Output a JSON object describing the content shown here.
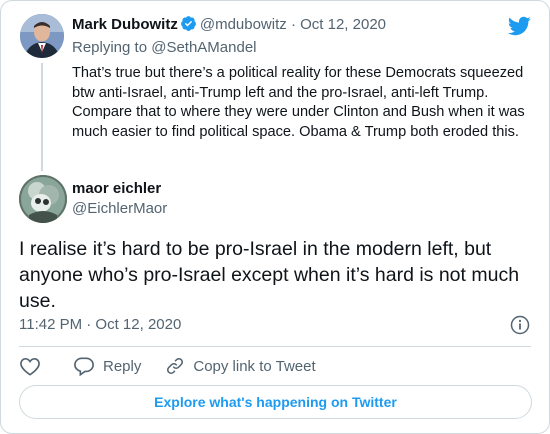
{
  "parent_tweet": {
    "author_name": "Mark Dubowitz",
    "author_handle": "@mdubowitz",
    "separator": "·",
    "date": "Oct 12, 2020",
    "replying_prefix": "Replying to",
    "replying_to": "@SethAMandel",
    "text": "That’s true but there’s a political reality for these Democrats squeezed btw anti-Israel, anti-Trump left and the pro-Israel, anti-left Trump. Compare that to where they were under Clinton and Bush when it was much easier to find political space. Obama & Trump both eroded this."
  },
  "main_tweet": {
    "author_name": "maor eichler",
    "author_handle": "@EichlerMaor",
    "text": "I realise it’s hard to be pro-Israel in the modern left, but anyone who’s pro-Israel except when it’s hard is not much use.",
    "timestamp": "11:42 PM · Oct 12, 2020"
  },
  "actions": {
    "like_icon": "heart-icon",
    "reply_label": "Reply",
    "copy_link_label": "Copy link to Tweet"
  },
  "explore_button_label": "Explore what's happening on Twitter",
  "colors": {
    "brand_blue": "#1d9bf0",
    "text_primary": "#0f1419",
    "text_secondary": "#536471",
    "border": "#cfd9de"
  }
}
